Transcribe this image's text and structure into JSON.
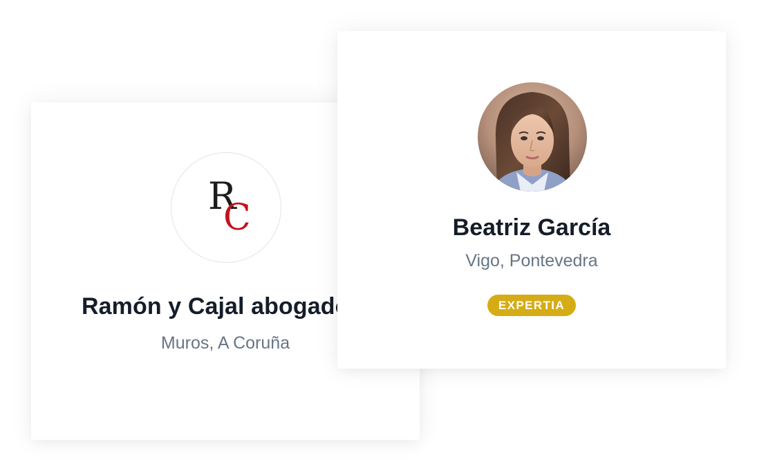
{
  "cards": [
    {
      "name": "Ramón y Cajal abogados",
      "location": "Muros, A Coruña",
      "logo": {
        "icon": "rc-monogram-logo",
        "letter_r": "R",
        "letter_c": "C",
        "color_r": "#1c1c1c",
        "color_c": "#c2121c"
      }
    },
    {
      "name": "Beatriz García",
      "location": "Vigo, Pontevedra",
      "avatar": {
        "icon": "profile-photo"
      },
      "badge": {
        "label": "EXPERTIA",
        "color": "#d6ac16"
      }
    }
  ],
  "colors": {
    "name_text": "#151d29",
    "location_text": "#667585",
    "card_background": "#ffffff"
  }
}
